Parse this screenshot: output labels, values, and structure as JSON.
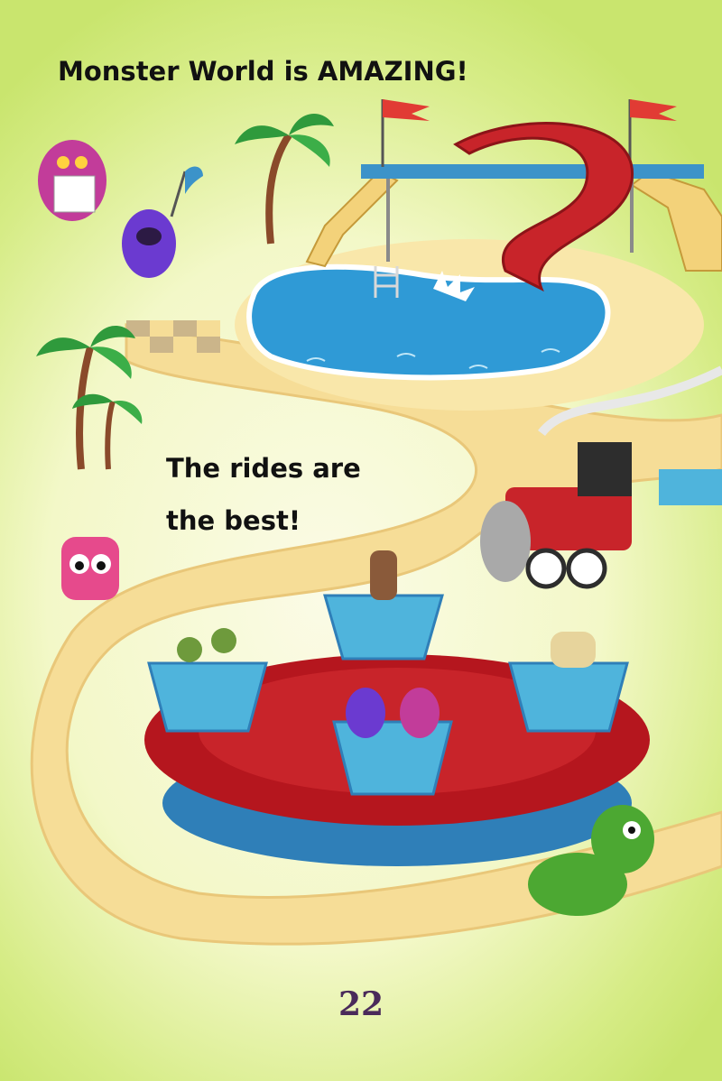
{
  "page": {
    "heading": "Monster World is AMAZING!",
    "body_lines": [
      "The rides are",
      "the best!"
    ],
    "page_number": "22"
  },
  "colors": {
    "background_edge": "#c9e56e",
    "path_sand": "#f6dd97",
    "pool_water": "#2f9ad6",
    "slide_red": "#c8242a",
    "teacup_blue": "#4fb4dc",
    "platform_red": "#b5161e",
    "text": "#111111",
    "page_number": "#4a2a5a"
  },
  "icons": [
    "palm-tree-icon",
    "water-slide-icon",
    "pool-icon",
    "train-icon",
    "teacup-icon",
    "monster-icon",
    "flag-icon"
  ]
}
